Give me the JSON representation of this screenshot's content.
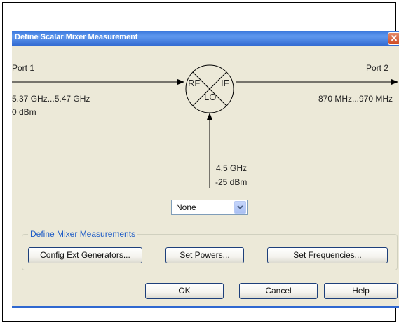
{
  "dialog": {
    "title": "Define Scalar Mixer Measurement",
    "close_glyph": "✕"
  },
  "ports": {
    "port1_label": "Port 1",
    "port1_freq": "5.37 GHz...5.47 GHz",
    "port1_power": "0 dBm",
    "port2_label": "Port 2",
    "port2_freq": "870 MHz...970 MHz"
  },
  "mixer": {
    "rf_label": "RF",
    "if_label": "IF",
    "lo_label": "LO",
    "lo_freq": "4.5 GHz",
    "lo_power": "-25 dBm"
  },
  "lo_source_select": {
    "value": "None"
  },
  "group": {
    "legend": "Define Mixer Measurements",
    "config_ext_generators_label": "Config Ext Generators...",
    "set_powers_label": "Set Powers...",
    "set_frequencies_label": "Set Frequencies..."
  },
  "footer": {
    "ok_label": "OK",
    "cancel_label": "Cancel",
    "help_label": "Help"
  },
  "colors": {
    "titlebar": "#2f68d0",
    "dialog_bg": "#ece9d8",
    "group_legend": "#1e5cc6",
    "close_button": "#cf4b24"
  },
  "icons": {
    "close": "close-icon",
    "dropdown": "chevron-down-icon",
    "mixer": "mixer-symbol-icon"
  }
}
